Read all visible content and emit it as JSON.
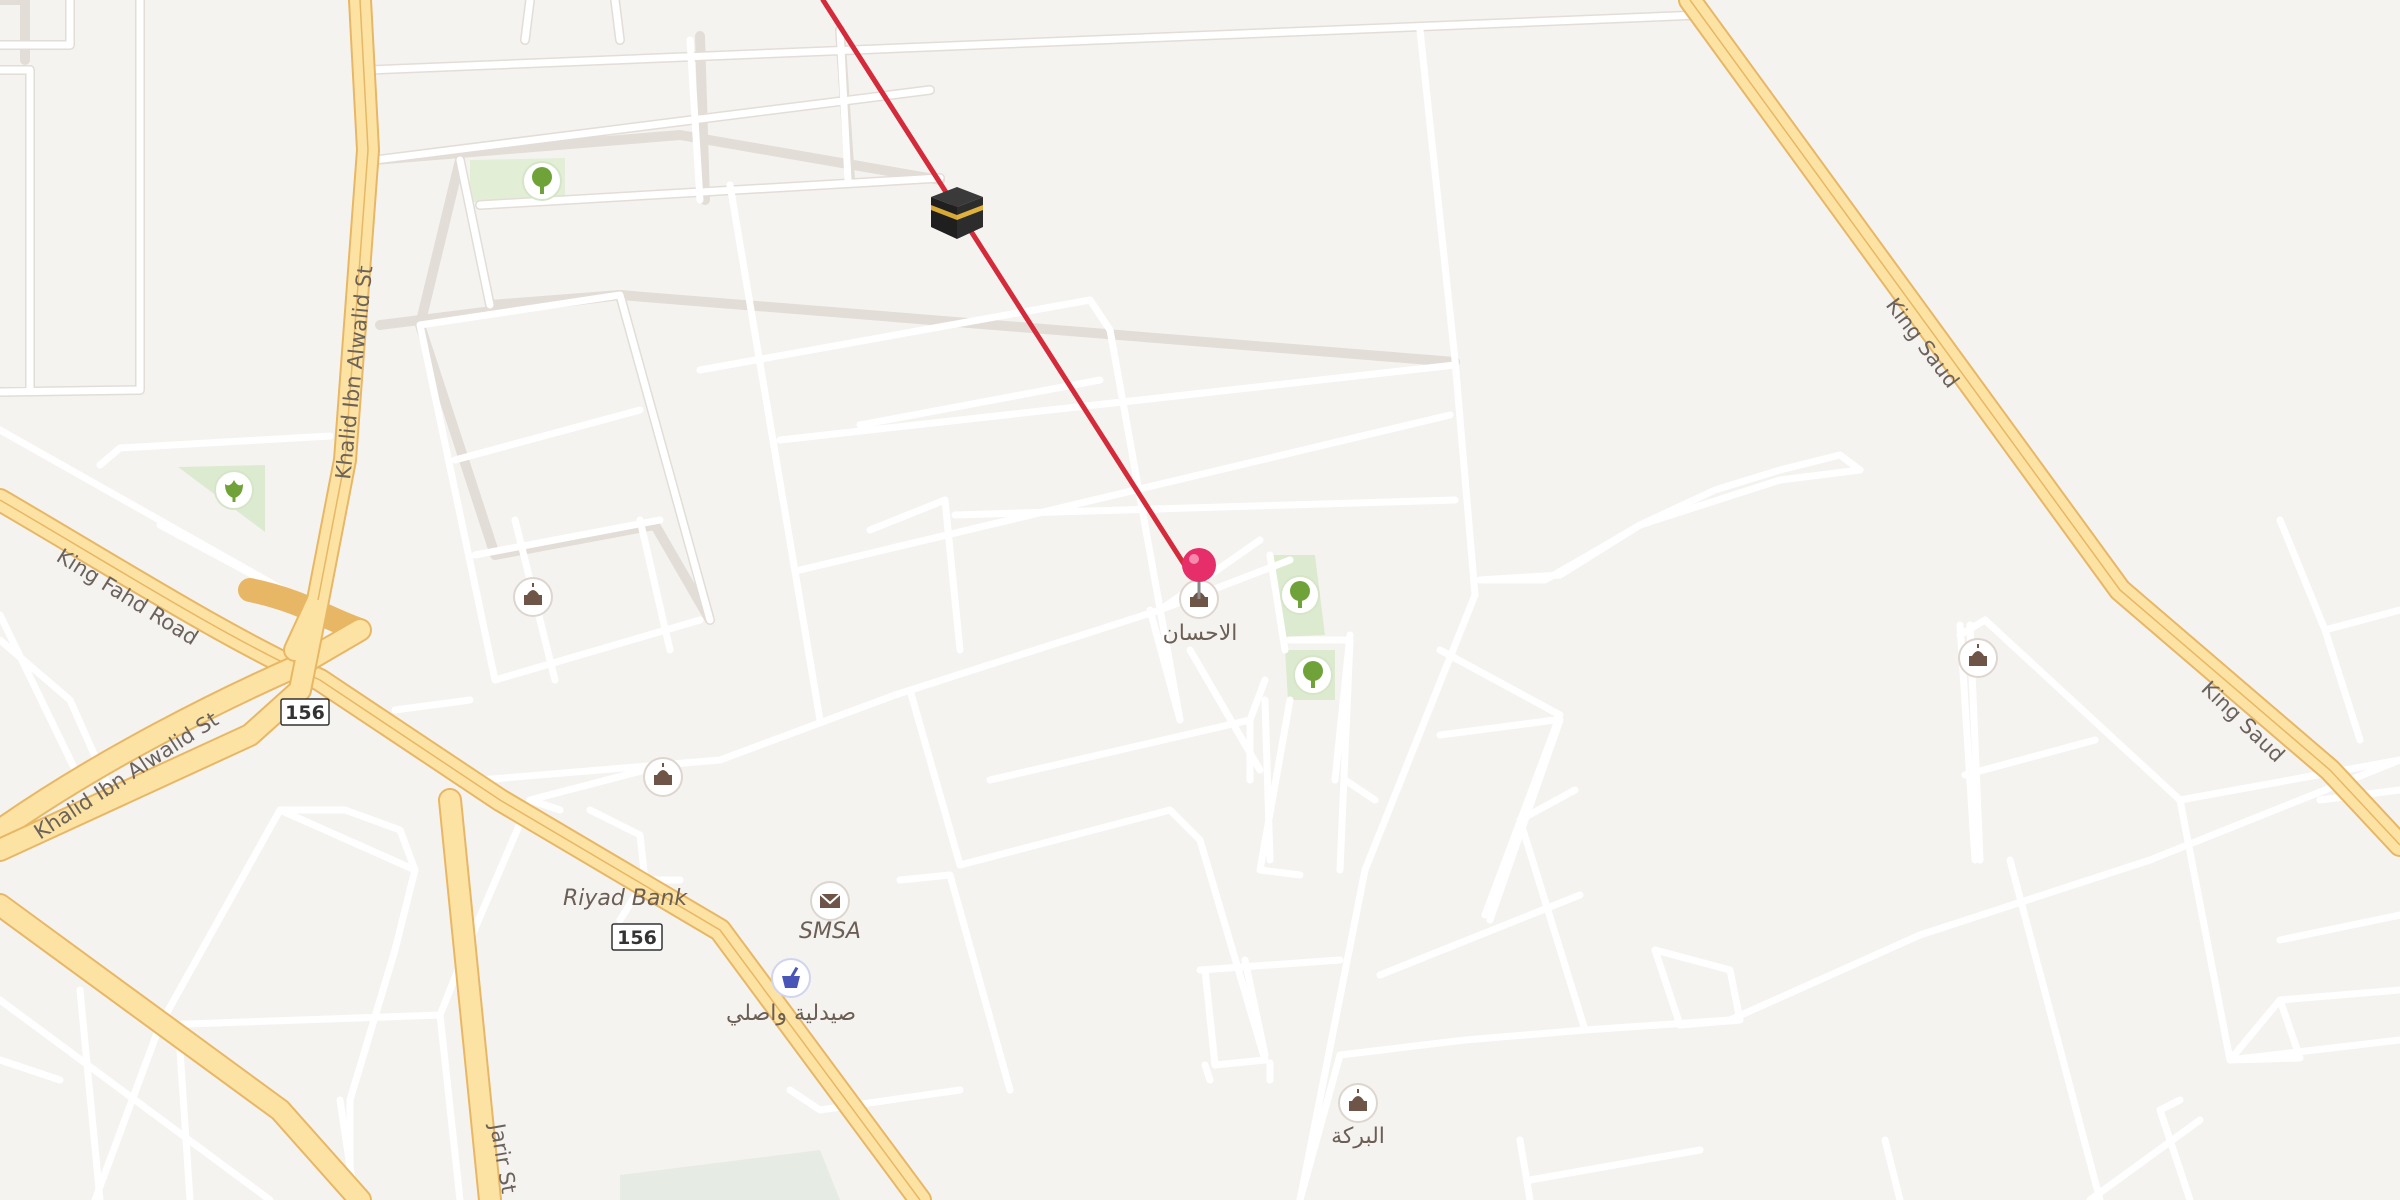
{
  "map": {
    "roads": {
      "khalid_1": "Khalid Ibn Alwalid St",
      "khalid_2": "Khalid Ibn Alwalid St",
      "king_fahd": "King Fahd Road",
      "king_saud_1": "King Saud",
      "king_saud_2": "King Saud",
      "jarir": "Jarir St"
    },
    "shields": {
      "s1": "156",
      "s2": "156"
    },
    "pois": {
      "mosque_ihsan": "الاحسان",
      "mosque_baraka": "البركة",
      "bank": "Riyad Bank",
      "post": "SMSA",
      "pharmacy": "صيدلية واصلي"
    },
    "icons": {
      "kaaba": "kaaba-icon",
      "pin": "location-pin-icon",
      "mosque": "mosque-icon",
      "park": "tree-icon",
      "garden": "flower-icon",
      "post": "envelope-icon",
      "pharmacy": "pharmacy-icon"
    },
    "colors": {
      "qibla_line": "#d42a3a",
      "pin": "#e62e6b",
      "major_road": "#fce3a3",
      "park": "#d9ecc8"
    }
  }
}
